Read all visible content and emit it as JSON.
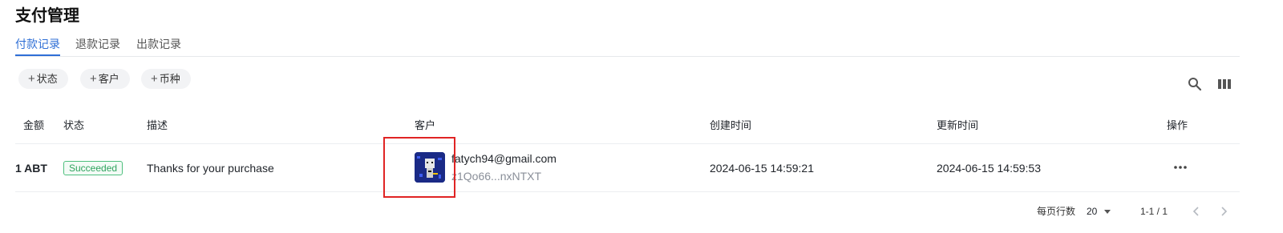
{
  "page": {
    "title": "支付管理"
  },
  "tabs": [
    {
      "label": "付款记录",
      "active": true
    },
    {
      "label": "退款记录",
      "active": false
    },
    {
      "label": "出款记录",
      "active": false
    }
  ],
  "filters": [
    {
      "label": "状态",
      "icon": "plus-icon"
    },
    {
      "label": "客户",
      "icon": "plus-icon"
    },
    {
      "label": "币种",
      "icon": "plus-icon"
    }
  ],
  "toolbar": {
    "search_icon": "search-icon",
    "columns_icon": "columns-icon"
  },
  "table": {
    "columns": [
      "金额",
      "状态",
      "描述",
      "客户",
      "创建时间",
      "更新时间",
      "操作"
    ],
    "rows": [
      {
        "amount": "1 ABT",
        "status": "Succeeded",
        "description": "Thanks for your purchase",
        "customer_email": "fatych94@gmail.com",
        "customer_id": "z1Qo66...nxNTXT",
        "created": "2024-06-15 14:59:21",
        "updated": "2024-06-15 14:59:53",
        "action_icon": "more-icon"
      }
    ]
  },
  "pagination": {
    "rows_per_page_label": "每页行数",
    "rows_per_page": "20",
    "range": "1-1 / 1"
  },
  "colors": {
    "accent": "#2f6fd6",
    "success": "#2fa35e",
    "highlight": "#e02424"
  }
}
